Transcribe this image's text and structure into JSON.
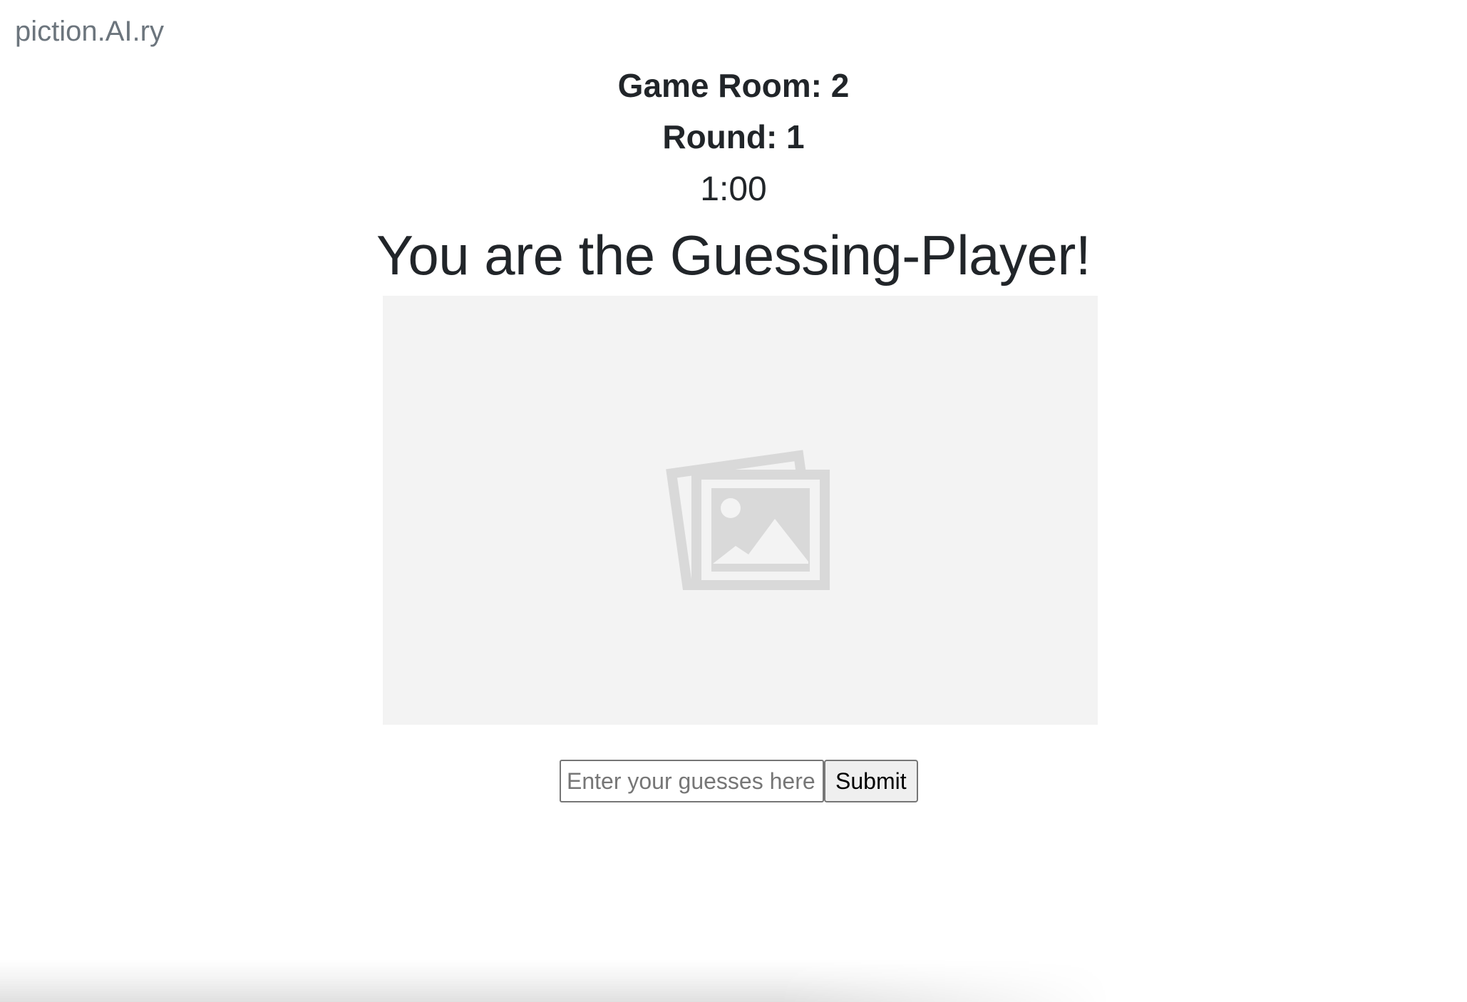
{
  "brand": "piction.AI.ry",
  "game": {
    "room_label": "Game Room: 2",
    "round_label": "Round: 1",
    "timer": "1:00",
    "role_heading": "You are the Guessing-Player!"
  },
  "image": {
    "icon": "image-placeholder-icon",
    "background": "#f3f3f3"
  },
  "guess_form": {
    "placeholder": "Enter your guesses here",
    "value": "",
    "submit_label": "Submit"
  }
}
